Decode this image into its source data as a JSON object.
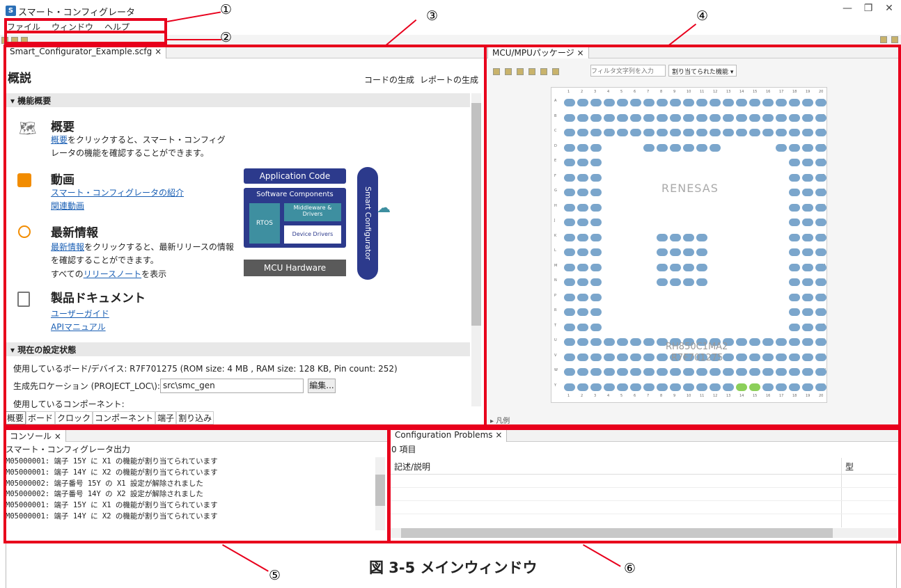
{
  "window": {
    "title": "スマート・コンフィグレータ",
    "controls": [
      "—",
      "❐",
      "✕"
    ]
  },
  "menu": [
    "ファイル",
    "ウィンドウ",
    "ヘルプ"
  ],
  "callouts": [
    "①",
    "②",
    "③",
    "④",
    "⑤",
    "⑥"
  ],
  "overview_panel": {
    "tab": "Smart_Configurator_Example.scfg",
    "heading": "概説",
    "gen_code": "コードの生成",
    "gen_report": "レポートの生成",
    "section1": "機能概要",
    "overview_title": "概要",
    "overview_link": "概要",
    "overview_text1": "をクリックすると、スマート・コンフィグ",
    "overview_text2": "レータの機能を確認することができます。",
    "video_title": "動画",
    "video_link1": "スマート・コンフィグレータの紹介",
    "video_link2": "関連動画",
    "news_title": "最新情報",
    "news_link": "最新情報",
    "news_text1": "をクリックすると、最新リリースの情報",
    "news_text2": "を確認することができます。",
    "news_text3a": "すべての",
    "news_text3_link": "リリースノート",
    "news_text3b": "を表示",
    "docs_title": "製品ドキュメント",
    "docs_link1": "ユーザーガイド",
    "docs_link2": "APIマニュアル",
    "diagram": {
      "app": "Application Code",
      "sw": "Software Components",
      "mw": "Middleware & Drivers",
      "rtos": "RTOS",
      "dd": "Device Drivers",
      "hw": "MCU Hardware",
      "sc": "Smart Configurator"
    },
    "section2": "現在の設定状態",
    "board": "使用しているボード/デバイス: R7F701275 (ROM size: 4 MB , RAM size: 128 KB, Pin count: 252)",
    "loc_label": "生成先ロケーション (PROJECT_LOC\\):",
    "loc_value": "src\\smc_gen",
    "edit": "編集...",
    "components": "使用しているコンポーネント:",
    "bottom_tabs": [
      "概要",
      "ボード",
      "クロック",
      "コンポーネント",
      "端子",
      "割り込み"
    ]
  },
  "package_panel": {
    "tab": "MCU/MPUパッケージ",
    "filter_placeholder": "フィルタ文字列を入力",
    "assigned": "割り当てられた機能",
    "brand": "RENESAS",
    "chip_name": "RH850C1MA2",
    "part": "R7F701275",
    "legend": "▸ 凡例",
    "col_labels": [
      "1",
      "2",
      "3",
      "4",
      "5",
      "6",
      "7",
      "8",
      "9",
      "10",
      "11",
      "12",
      "13",
      "14",
      "15",
      "16",
      "17",
      "18",
      "19",
      "20"
    ],
    "row_labels": [
      "A",
      "B",
      "C",
      "D",
      "E",
      "F",
      "G",
      "H",
      "J",
      "K",
      "L",
      "M",
      "N",
      "P",
      "R",
      "T",
      "U",
      "V",
      "W",
      "Y"
    ]
  },
  "console_panel": {
    "tab": "コンソール",
    "subtitle": "スマート・コンフィグレータ出力",
    "lines": [
      "M05000001: 端子 15Y に X1 の機能が割り当てられています",
      "M05000001: 端子 14Y に X2 の機能が割り当てられています",
      "M05000002: 端子番号 15Y の X1 設定が解除されました",
      "M05000002: 端子番号 14Y の X2 設定が解除されました",
      "M05000001: 端子 15Y に X1 の機能が割り当てられています",
      "M05000001: 端子 14Y に X2 の機能が割り当てられています"
    ]
  },
  "problems_panel": {
    "tab": "Configuration Problems",
    "count": "0 項目",
    "col_desc": "記述/説明",
    "col_type": "型"
  },
  "caption": "図 3-5 メインウィンドウ",
  "colors": {
    "accent_red": "#e8001c",
    "link_blue": "#1a5fb4",
    "pin_blue": "#7ba6cc",
    "diagram_navy": "#2c3a8c"
  }
}
